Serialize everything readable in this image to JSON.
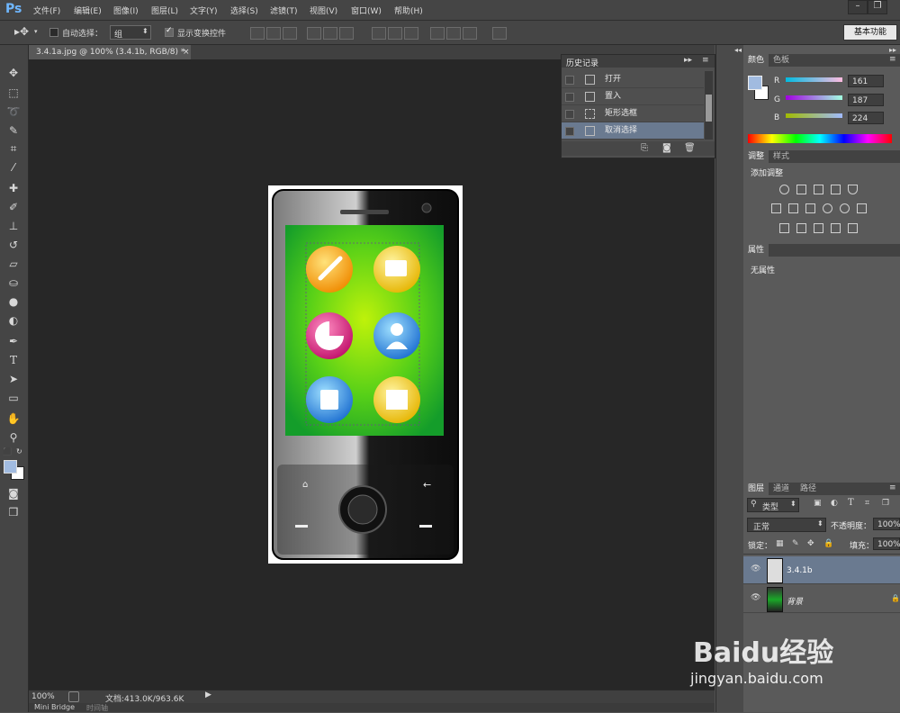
{
  "app": {
    "logo": "Ps"
  },
  "menu": [
    "文件(F)",
    "编辑(E)",
    "图像(I)",
    "图层(L)",
    "文字(Y)",
    "选择(S)",
    "滤镜(T)",
    "视图(V)",
    "窗口(W)",
    "帮助(H)"
  ],
  "options": {
    "auto_select_label": "自动选择：",
    "auto_select_value": "组",
    "show_transform_label": "显示变换控件",
    "workspace": "基本功能"
  },
  "document": {
    "tab_title": "3.4.1a.jpg @ 100% (3.4.1b, RGB/8) *",
    "tab_close": "×"
  },
  "status": {
    "zoom": "100%",
    "doc_info": "文档:413.0K/963.6K"
  },
  "bottom_tabs": [
    "Mini Bridge",
    "时间轴"
  ],
  "history": {
    "title": "历史记录",
    "items": [
      {
        "label": "打开"
      },
      {
        "label": "置入"
      },
      {
        "label": "矩形选框"
      },
      {
        "label": "取消选择"
      }
    ]
  },
  "color_panel": {
    "tabs": [
      "颜色",
      "色板"
    ],
    "r_label": "R",
    "g_label": "G",
    "b_label": "B",
    "r": "161",
    "g": "187",
    "b": "224",
    "fg_color": "#a1bbe0"
  },
  "adjust_panel": {
    "tabs": [
      "调整",
      "样式"
    ],
    "title": "添加调整"
  },
  "props_panel": {
    "title": "属性",
    "empty": "无属性"
  },
  "layers_panel": {
    "tabs": [
      "图层",
      "通道",
      "路径"
    ],
    "filter": "类型",
    "blend_mode": "正常",
    "opacity_label": "不透明度：",
    "opacity": "100%",
    "lock_label": "锁定：",
    "fill_label": "填充：",
    "fill": "100%",
    "layers": [
      {
        "name": "3.4.1b"
      },
      {
        "name": "背景"
      }
    ]
  },
  "watermark": {
    "brand": "Baidu经验",
    "url": "jingyan.baidu.com"
  }
}
